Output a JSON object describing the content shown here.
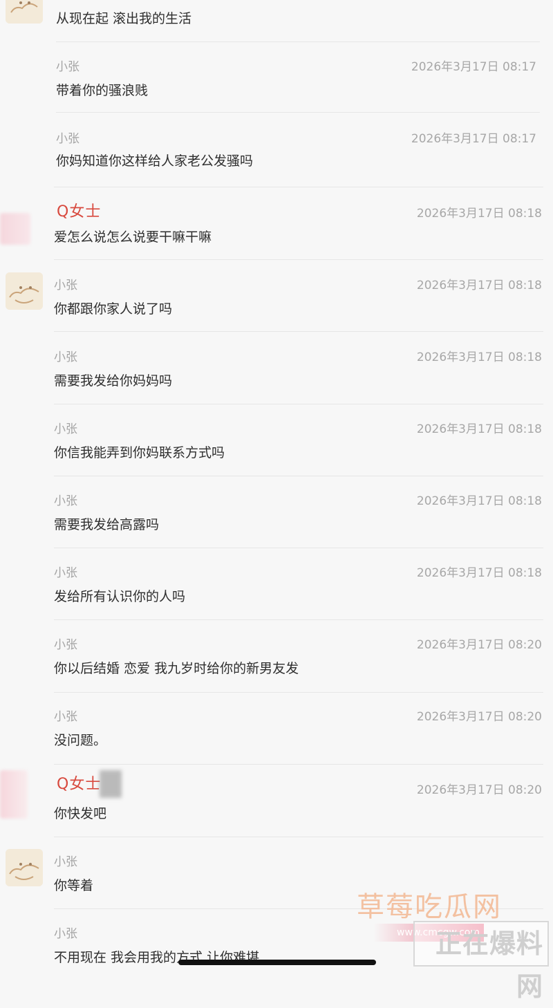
{
  "messages": [
    {
      "sender": "",
      "time": "",
      "text": "从现在起 滚出我的生活"
    },
    {
      "sender": "小张",
      "time": "2026年3月17日 08:17",
      "text": "带着你的骚浪贱"
    },
    {
      "sender": "小张",
      "time": "2026年3月17日 08:17",
      "text": "你妈知道你这样给人家老公发骚吗"
    },
    {
      "sender": "Q女士",
      "time": "2026年3月17日 08:18",
      "text": "爱怎么说怎么说要干嘛干嘛"
    },
    {
      "sender": "小张",
      "time": "2026年3月17日 08:18",
      "text": "你都跟你家人说了吗"
    },
    {
      "sender": "小张",
      "time": "2026年3月17日 08:18",
      "text": "需要我发给你妈妈吗"
    },
    {
      "sender": "小张",
      "time": "2026年3月17日 08:18",
      "text": "你信我能弄到你妈联系方式吗"
    },
    {
      "sender": "小张",
      "time": "2026年3月17日 08:18",
      "text": "需要我发给高露吗"
    },
    {
      "sender": "小张",
      "time": "2026年3月17日 08:18",
      "text": "发给所有认识你的人吗"
    },
    {
      "sender": "小张",
      "time": "2026年3月17日 08:20",
      "text": "你以后结婚 恋爱 我九岁时给你的新男友发"
    },
    {
      "sender": "小张",
      "time": "2026年3月17日 08:20",
      "text": "没问题。"
    },
    {
      "sender": "Q女士",
      "time": "2026年3月17日 08:20",
      "text": "你快发吧"
    },
    {
      "sender": "小张",
      "time": "",
      "text": "你等着"
    },
    {
      "sender": "小张",
      "time": "",
      "text": "不用现在 我会用我的方式 让你难堪"
    }
  ],
  "watermark": {
    "title": "草莓吃瓜网",
    "url": "www.cmcgw.com",
    "logo": "正在爆料网"
  },
  "colors": {
    "background": "#f7f7f7",
    "sender_grey": "#a4a4a4",
    "sender_q": "#d84a3f",
    "message_text": "#2e2e2e"
  }
}
